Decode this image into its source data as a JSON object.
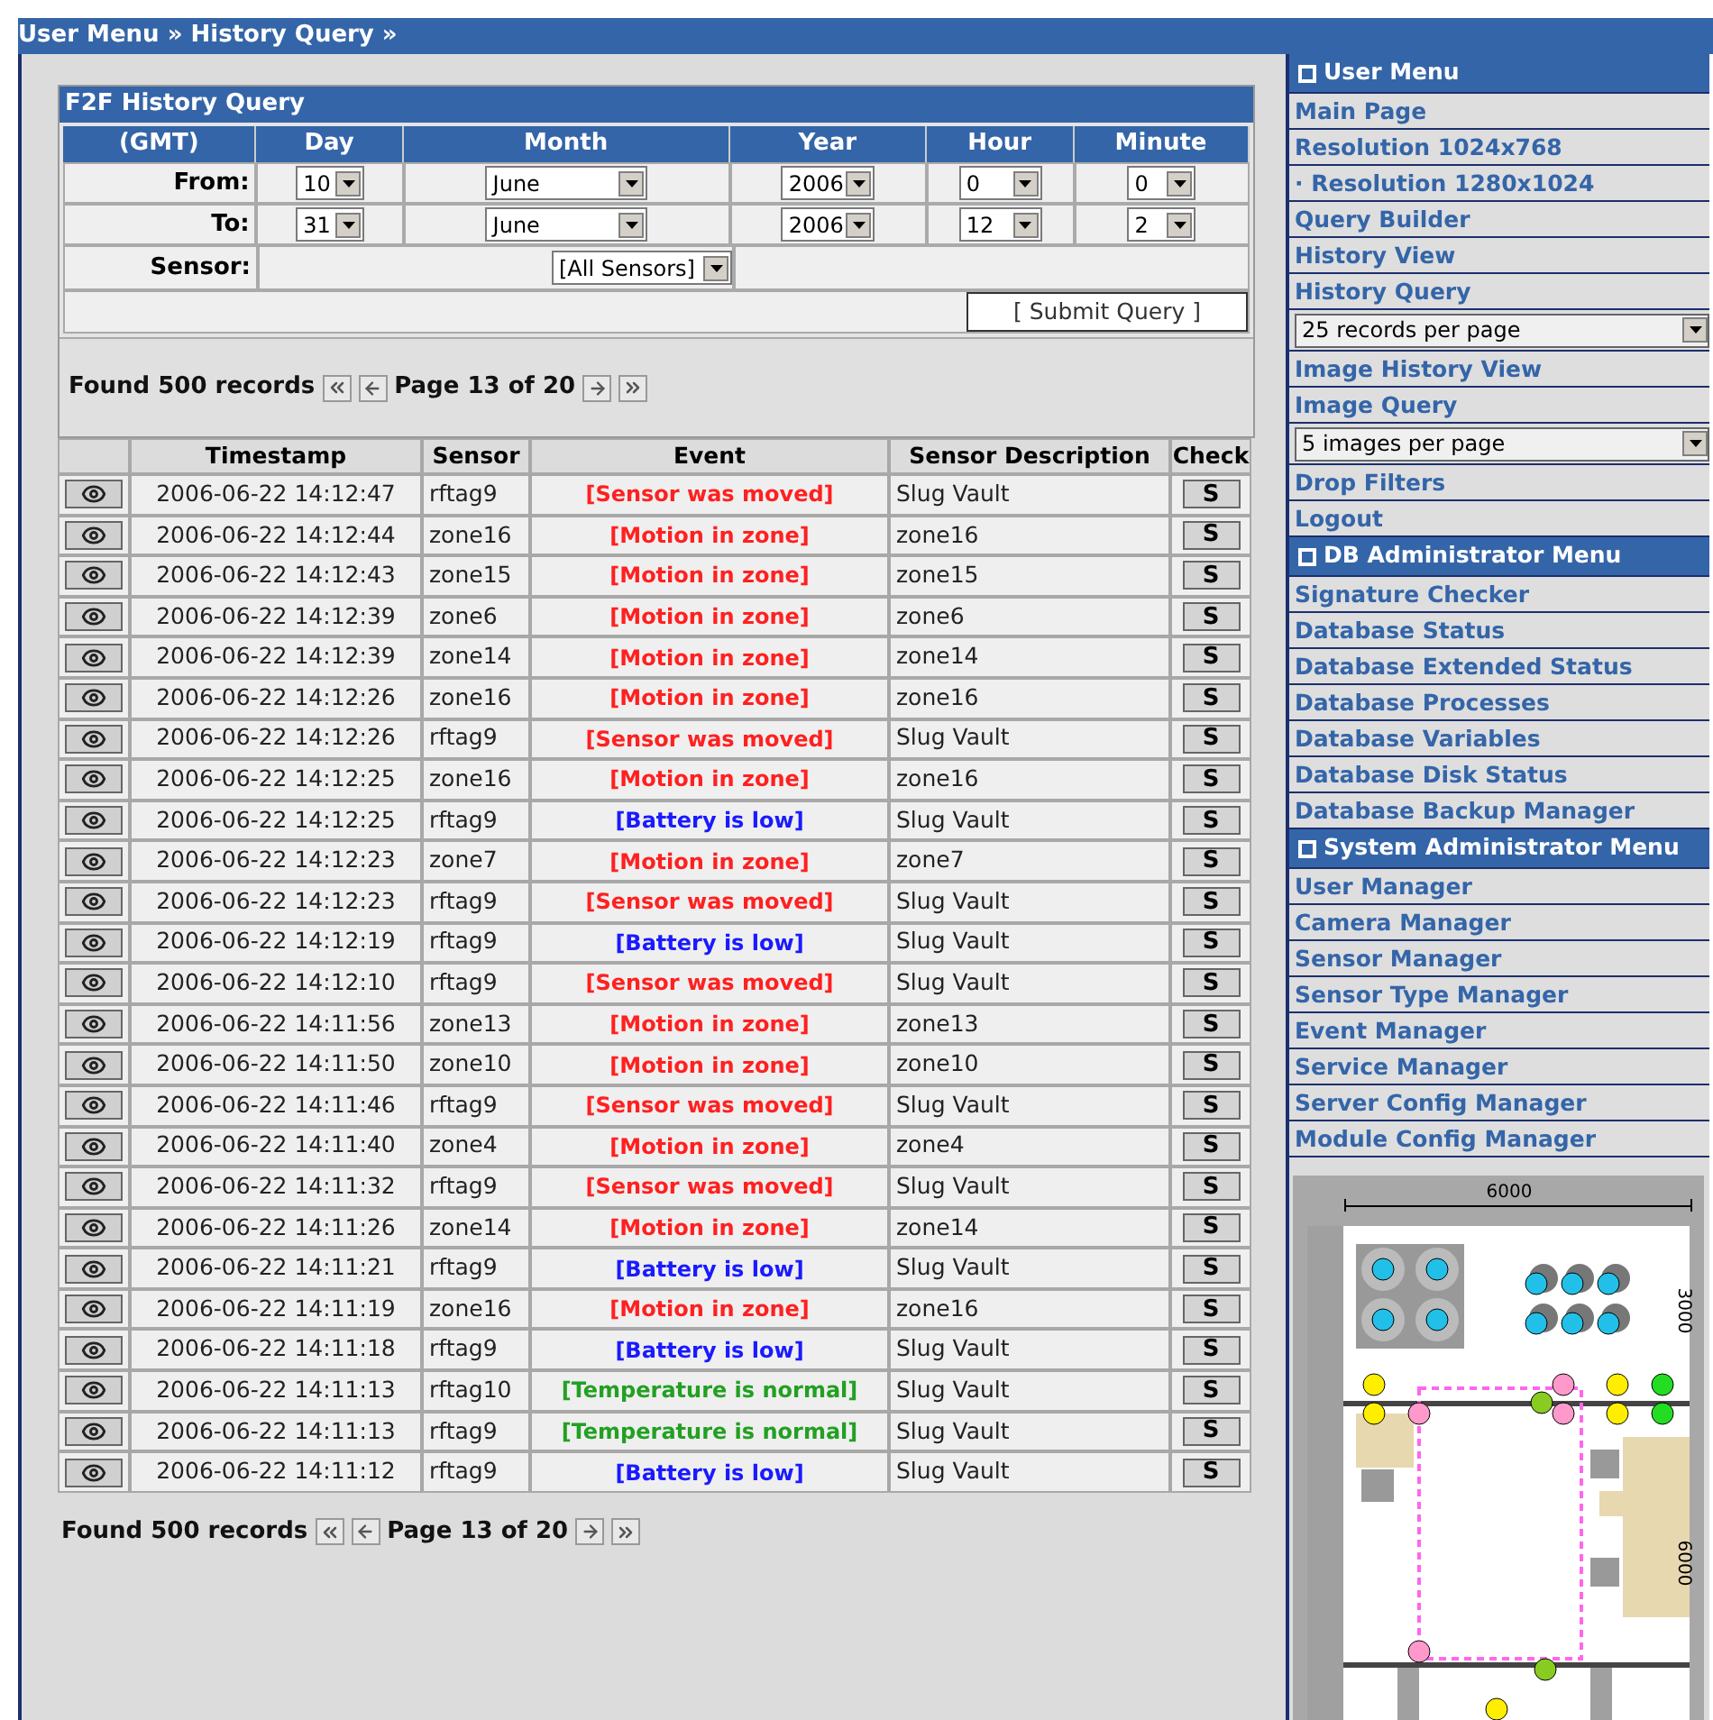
{
  "breadcrumb": "User Menu » History Query »",
  "query": {
    "title": "F2F History Query",
    "columns": [
      "(GMT)",
      "Day",
      "Month",
      "Year",
      "Hour",
      "Minute"
    ],
    "rows": [
      {
        "label": "From:",
        "fields": [
          "10",
          "June",
          "2006",
          "0",
          "0"
        ]
      },
      {
        "label": "To:",
        "fields": [
          "31",
          "June",
          "2006",
          "12",
          "2"
        ]
      }
    ],
    "sensor": {
      "label": "Sensor:",
      "value": "[All Sensors]"
    },
    "submit": "[ Submit Query ]"
  },
  "pager_top": {
    "found": "Found 500 records",
    "page": "Page 13 of 20"
  },
  "table": {
    "columns": [
      "Timestamp",
      "Sensor",
      "Event",
      "Sensor Description",
      "Check"
    ],
    "rows": [
      {
        "timestamp": "2006-06-22 14:12:47",
        "sensor": "rftag9",
        "event": "[Sensor was moved]",
        "color": "#ff2020",
        "description": "Slug Vault",
        "check": "S"
      },
      {
        "timestamp": "2006-06-22 14:12:44",
        "sensor": "zone16",
        "event": "[Motion in zone]",
        "color": "#ff2020",
        "description": "zone16",
        "check": "S"
      },
      {
        "timestamp": "2006-06-22 14:12:43",
        "sensor": "zone15",
        "event": "[Motion in zone]",
        "color": "#ff2020",
        "description": "zone15",
        "check": "S"
      },
      {
        "timestamp": "2006-06-22 14:12:39",
        "sensor": "zone6",
        "event": "[Motion in zone]",
        "color": "#ff2020",
        "description": "zone6",
        "check": "S"
      },
      {
        "timestamp": "2006-06-22 14:12:39",
        "sensor": "zone14",
        "event": "[Motion in zone]",
        "color": "#ff2020",
        "description": "zone14",
        "check": "S"
      },
      {
        "timestamp": "2006-06-22 14:12:26",
        "sensor": "zone16",
        "event": "[Motion in zone]",
        "color": "#ff2020",
        "description": "zone16",
        "check": "S"
      },
      {
        "timestamp": "2006-06-22 14:12:26",
        "sensor": "rftag9",
        "event": "[Sensor was moved]",
        "color": "#ff2020",
        "description": "Slug Vault",
        "check": "S"
      },
      {
        "timestamp": "2006-06-22 14:12:25",
        "sensor": "zone16",
        "event": "[Motion in zone]",
        "color": "#ff2020",
        "description": "zone16",
        "check": "S"
      },
      {
        "timestamp": "2006-06-22 14:12:25",
        "sensor": "rftag9",
        "event": "[Battery is low]",
        "color": "#1a1aff",
        "description": "Slug Vault",
        "check": "S"
      },
      {
        "timestamp": "2006-06-22 14:12:23",
        "sensor": "zone7",
        "event": "[Motion in zone]",
        "color": "#ff2020",
        "description": "zone7",
        "check": "S"
      },
      {
        "timestamp": "2006-06-22 14:12:23",
        "sensor": "rftag9",
        "event": "[Sensor was moved]",
        "color": "#ff2020",
        "description": "Slug Vault",
        "check": "S"
      },
      {
        "timestamp": "2006-06-22 14:12:19",
        "sensor": "rftag9",
        "event": "[Battery is low]",
        "color": "#1a1aff",
        "description": "Slug Vault",
        "check": "S"
      },
      {
        "timestamp": "2006-06-22 14:12:10",
        "sensor": "rftag9",
        "event": "[Sensor was moved]",
        "color": "#ff2020",
        "description": "Slug Vault",
        "check": "S"
      },
      {
        "timestamp": "2006-06-22 14:11:56",
        "sensor": "zone13",
        "event": "[Motion in zone]",
        "color": "#ff2020",
        "description": "zone13",
        "check": "S"
      },
      {
        "timestamp": "2006-06-22 14:11:50",
        "sensor": "zone10",
        "event": "[Motion in zone]",
        "color": "#ff2020",
        "description": "zone10",
        "check": "S"
      },
      {
        "timestamp": "2006-06-22 14:11:46",
        "sensor": "rftag9",
        "event": "[Sensor was moved]",
        "color": "#ff2020",
        "description": "Slug Vault",
        "check": "S"
      },
      {
        "timestamp": "2006-06-22 14:11:40",
        "sensor": "zone4",
        "event": "[Motion in zone]",
        "color": "#ff2020",
        "description": "zone4",
        "check": "S"
      },
      {
        "timestamp": "2006-06-22 14:11:32",
        "sensor": "rftag9",
        "event": "[Sensor was moved]",
        "color": "#ff2020",
        "description": "Slug Vault",
        "check": "S"
      },
      {
        "timestamp": "2006-06-22 14:11:26",
        "sensor": "zone14",
        "event": "[Motion in zone]",
        "color": "#ff2020",
        "description": "zone14",
        "check": "S"
      },
      {
        "timestamp": "2006-06-22 14:11:21",
        "sensor": "rftag9",
        "event": "[Battery is low]",
        "color": "#1a1aff",
        "description": "Slug Vault",
        "check": "S"
      },
      {
        "timestamp": "2006-06-22 14:11:19",
        "sensor": "zone16",
        "event": "[Motion in zone]",
        "color": "#ff2020",
        "description": "zone16",
        "check": "S"
      },
      {
        "timestamp": "2006-06-22 14:11:18",
        "sensor": "rftag9",
        "event": "[Battery is low]",
        "color": "#1a1aff",
        "description": "Slug Vault",
        "check": "S"
      },
      {
        "timestamp": "2006-06-22 14:11:13",
        "sensor": "rftag10",
        "event": "[Temperature is normal]",
        "color": "#22a022",
        "description": "Slug Vault",
        "check": "S"
      },
      {
        "timestamp": "2006-06-22 14:11:13",
        "sensor": "rftag9",
        "event": "[Temperature is normal]",
        "color": "#22a022",
        "description": "Slug Vault",
        "check": "S"
      },
      {
        "timestamp": "2006-06-22 14:11:12",
        "sensor": "rftag9",
        "event": "[Battery is low]",
        "color": "#1a1aff",
        "description": "Slug Vault",
        "check": "S"
      }
    ]
  },
  "pager_bottom": {
    "found": "Found 500 records",
    "page": "Page 13 of 20"
  },
  "sidebar": [
    {
      "title": "User Menu",
      "items": [
        {
          "kind": "link",
          "label": "Main Page"
        },
        {
          "kind": "link",
          "label": "Resolution 1024x768"
        },
        {
          "kind": "link",
          "label": "· Resolution 1280x1024"
        },
        {
          "kind": "link",
          "label": "Query Builder"
        },
        {
          "kind": "link",
          "label": "History View"
        },
        {
          "kind": "link",
          "label": "History Query"
        },
        {
          "kind": "select",
          "label": "25 records per page"
        },
        {
          "kind": "link",
          "label": "Image History View"
        },
        {
          "kind": "link",
          "label": "Image Query"
        },
        {
          "kind": "select",
          "label": "5 images per page"
        },
        {
          "kind": "link",
          "label": "Drop Filters"
        },
        {
          "kind": "link",
          "label": "Logout"
        }
      ]
    },
    {
      "title": "DB Administrator Menu",
      "items": [
        {
          "kind": "link",
          "label": "Signature Checker"
        },
        {
          "kind": "link",
          "label": "Database Status"
        },
        {
          "kind": "link",
          "label": "Database Extended Status"
        },
        {
          "kind": "link",
          "label": "Database Processes"
        },
        {
          "kind": "link",
          "label": "Database Variables"
        },
        {
          "kind": "link",
          "label": "Database Disk Status"
        },
        {
          "kind": "link",
          "label": "Database Backup Manager"
        }
      ]
    },
    {
      "title": "System Administrator Menu",
      "items": [
        {
          "kind": "link",
          "label": "User Manager"
        },
        {
          "kind": "link",
          "label": "Camera Manager"
        },
        {
          "kind": "link",
          "label": "Sensor Manager"
        },
        {
          "kind": "link",
          "label": "Sensor Type Manager"
        },
        {
          "kind": "link",
          "label": "Event Manager"
        },
        {
          "kind": "link",
          "label": "Service Manager"
        },
        {
          "kind": "link",
          "label": "Server Config Manager"
        },
        {
          "kind": "link",
          "label": "Module Config Manager"
        }
      ]
    }
  ],
  "floor_plan": {
    "width_label": "6000",
    "upper_label": "3000",
    "lower_label": "6000"
  }
}
